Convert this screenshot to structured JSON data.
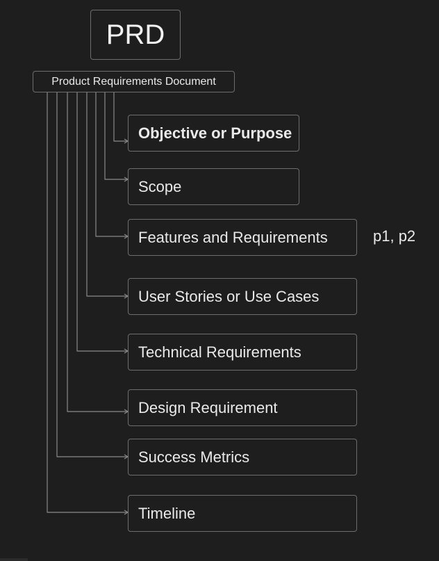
{
  "diagram": {
    "title": "PRD",
    "subtitle": "Product Requirements Document",
    "items": [
      {
        "label": "Objective or Purpose",
        "bold": true
      },
      {
        "label": "Scope",
        "bold": false
      },
      {
        "label": "Features and Requirements",
        "bold": false
      },
      {
        "label": "User Stories or Use Cases",
        "bold": false
      },
      {
        "label": "Technical Requirements",
        "bold": false
      },
      {
        "label": "Design Requirement",
        "bold": false
      },
      {
        "label": "Success Metrics",
        "bold": false
      },
      {
        "label": "Timeline",
        "bold": false
      }
    ],
    "side_note": "p1, p2",
    "colors": {
      "background": "#1e1e1e",
      "stroke": "#6e6e6e",
      "text": "#e9e9e9"
    }
  }
}
